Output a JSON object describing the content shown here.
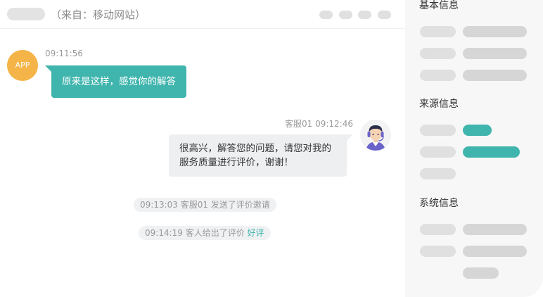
{
  "header": {
    "source": "（来自：移动网站）"
  },
  "messages": {
    "customer": {
      "avatar_text": "APP",
      "time": "09:11:56",
      "text": "原来是这样，感觉你的解答"
    },
    "agent": {
      "meta": "客服01 09:12:46",
      "text": "很高兴，解答您的问题，请您对我的服务质量进行评价，谢谢！"
    },
    "system": [
      {
        "text": "09:13:03 客服01 发送了评价邀请"
      },
      {
        "text": "09:14:19 客人给出了评价 ",
        "highlight": "好评"
      }
    ]
  },
  "sidebar": {
    "sections": [
      {
        "title": "基本信息"
      },
      {
        "title": "来源信息"
      },
      {
        "title": "系统信息"
      }
    ]
  },
  "colors": {
    "accent": "#3fb5ad",
    "app_badge": "#f4b447",
    "placeholder": "#e0e0e0"
  }
}
